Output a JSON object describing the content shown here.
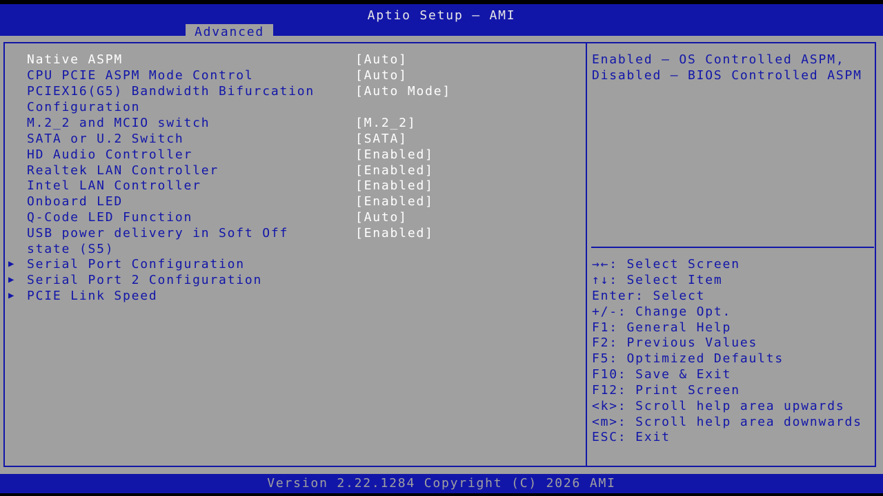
{
  "header": {
    "title": "Aptio Setup – AMI",
    "active_tab": "Advanced"
  },
  "settings": {
    "native_aspm": {
      "label": "Native ASPM",
      "value": "[Auto]"
    },
    "cpu_pcie_aspm": {
      "label": "CPU PCIE ASPM Mode Control",
      "value": "[Auto]"
    },
    "pciex16_bifurcation": {
      "label_line1": "PCIEX16(G5) Bandwidth Bifurcation",
      "label_line2": "Configuration",
      "value": "[Auto Mode]"
    },
    "m2_mcio_switch": {
      "label": "M.2_2 and MCIO switch",
      "value": "[M.2_2]"
    },
    "sata_u2_switch": {
      "label": "SATA or U.2 Switch",
      "value": "[SATA]"
    },
    "hd_audio": {
      "label": "HD Audio Controller",
      "value": "[Enabled]"
    },
    "realtek_lan": {
      "label": "Realtek LAN Controller",
      "value": "[Enabled]"
    },
    "intel_lan": {
      "label": "Intel LAN Controller",
      "value": "[Enabled]"
    },
    "onboard_led": {
      "label": "Onboard LED",
      "value": "[Enabled]"
    },
    "qcode_led": {
      "label": "Q-Code LED Function",
      "value": "[Auto]"
    },
    "usb_power_s5": {
      "label_line1": "USB power delivery in Soft Off",
      "label_line2": "state (S5)",
      "value": "[Enabled]"
    }
  },
  "submenus": {
    "serial_port": "Serial Port Configuration",
    "serial_port_2": "Serial Port 2 Configuration",
    "pcie_link_speed": "PCIE Link Speed"
  },
  "help": {
    "line1": "Enabled – OS Controlled ASPM,",
    "line2": "Disabled – BIOS Controlled ASPM"
  },
  "keys": {
    "select_screen": "→←: Select Screen",
    "select_item": "↑↓: Select Item",
    "enter": "Enter: Select",
    "change_opt": "+/-: Change Opt.",
    "f1": "F1: General Help",
    "f2": "F2: Previous Values",
    "f5": "F5: Optimized Defaults",
    "f10": "F10: Save & Exit",
    "f12": "F12: Print Screen",
    "scroll_up": "<k>: Scroll help area upwards",
    "scroll_down": "<m>: Scroll help area downwards",
    "esc": "ESC: Exit"
  },
  "footer": {
    "version": "Version 2.22.1284 Copyright (C) 2026 AMI"
  },
  "colors": {
    "bios_blue": "#1216a8",
    "panel_gray": "#a0a0a0",
    "selected_white": "#ffffff"
  },
  "icons": {
    "submenu_arrow": "right-triangle"
  }
}
